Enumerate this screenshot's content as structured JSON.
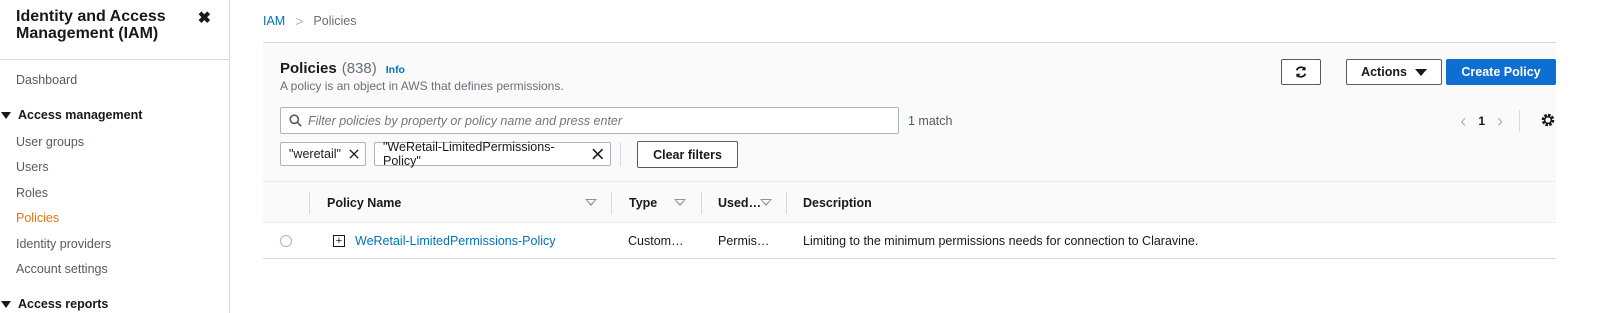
{
  "sidebar": {
    "title": "Identity and Access Management (IAM)",
    "close_icon": "close-icon",
    "dashboard": "Dashboard",
    "access_management": "Access management",
    "items": [
      {
        "label": "User groups",
        "active": false
      },
      {
        "label": "Users",
        "active": false
      },
      {
        "label": "Roles",
        "active": false
      },
      {
        "label": "Policies",
        "active": true
      },
      {
        "label": "Identity providers",
        "active": false
      },
      {
        "label": "Account settings",
        "active": false
      }
    ],
    "access_reports": "Access reports"
  },
  "breadcrumb": {
    "root": "IAM",
    "current": "Policies"
  },
  "panel": {
    "title": "Policies",
    "count": "(838)",
    "info": "Info",
    "description": "A policy is an object in AWS that defines permissions.",
    "actions_label": "Actions",
    "create_label": "Create Policy",
    "search_placeholder": "Filter policies by property or policy name and press enter",
    "match_text": "1 match",
    "page": "1",
    "tokens": [
      "\"weretail\"",
      "\"WeRetail-LimitedPermissions-Policy\""
    ],
    "clear_filters": "Clear filters"
  },
  "table": {
    "columns": [
      "Policy Name",
      "Type",
      "Used…",
      "Description"
    ],
    "rows": [
      {
        "name": "WeRetail-LimitedPermissions-Policy",
        "type": "Custom…",
        "used": "Permis…",
        "description": "Limiting to the minimum permissions needs for connection to Claravine."
      }
    ]
  },
  "colors": {
    "accent": "#0073bb",
    "primary_button": "#0e6fd3",
    "active_nav": "#ec7211"
  }
}
